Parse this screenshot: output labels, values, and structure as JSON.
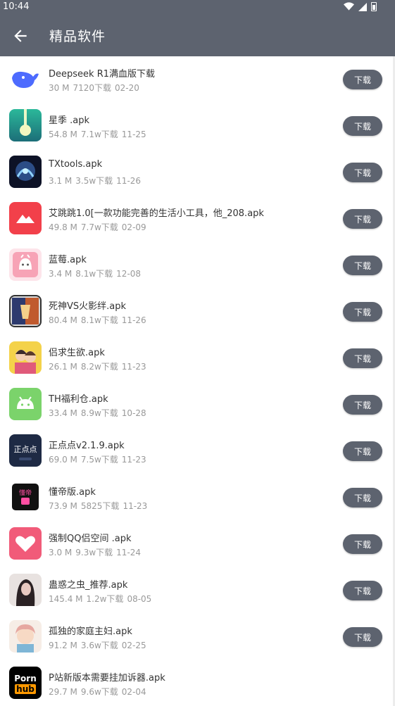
{
  "status_bar": {
    "time": "10:44"
  },
  "header": {
    "title": "精品软件"
  },
  "items": [
    {
      "name": "Deepseek R1满血版下载",
      "size": "30 M",
      "downloads": "7120下载",
      "date": "02-20",
      "button": "下载",
      "icon": "whale-icon",
      "color": "#4d6bfe"
    },
    {
      "name": "星季 .apk",
      "size": "54.8 M",
      "downloads": "7.1w下载",
      "date": "11-25",
      "button": "下载",
      "icon": "star-season-icon",
      "color": "#2f9e8a"
    },
    {
      "name": "TXtools.apk",
      "size": "3.1 M",
      "downloads": "3.5w下载",
      "date": "11-26",
      "button": "下载",
      "icon": "txtools-icon",
      "color": "#1a2440"
    },
    {
      "name": "艾跳跳1.0[一款功能完善的生活小工具，他_208.apk",
      "size": "49.8 M",
      "downloads": "7.7w下载",
      "date": "02-09",
      "button": "下载",
      "icon": "mountain-icon",
      "color": "#f2404a"
    },
    {
      "name": "蓝莓.apk",
      "size": "3.4 M",
      "downloads": "8.1w下载",
      "date": "12-08",
      "button": "下载",
      "icon": "blueberry-icon",
      "color": "#f7a3b6"
    },
    {
      "name": "死神VS火影绊.apk",
      "size": "80.4 M",
      "downloads": "8.1w下载",
      "date": "11-26",
      "button": "下载",
      "icon": "anime-fight-icon",
      "color": "#c05a2e"
    },
    {
      "name": "侣求生欲.apk",
      "size": "26.1 M",
      "downloads": "8.2w下载",
      "date": "11-23",
      "button": "下载",
      "icon": "couple-icon",
      "color": "#f4d24a"
    },
    {
      "name": "TH福利仓.apk",
      "size": "33.4 M",
      "downloads": "8.9w下载",
      "date": "10-28",
      "button": "下载",
      "icon": "android-icon",
      "color": "#7bd36b"
    },
    {
      "name": "正点点v2.1.9.apk",
      "size": "69.0 M",
      "downloads": "7.5w下载",
      "date": "11-23",
      "button": "下载",
      "icon": "zhengdiandian-icon",
      "color": "#1e2a44",
      "icon_text": "正点点"
    },
    {
      "name": "懂帝版.apk",
      "size": "73.9 M",
      "downloads": "5825下载",
      "date": "11-23",
      "button": "下载",
      "icon": "dongdi-icon",
      "color": "#111111"
    },
    {
      "name": "强制QQ侣空间 .apk",
      "size": "3.0 M",
      "downloads": "9.3w下载",
      "date": "11-24",
      "button": "下载",
      "icon": "heart-icon",
      "color": "#f15b79"
    },
    {
      "name": "蛊惑之虫_推荐.apk",
      "size": "145.4 M",
      "downloads": "1.2w下载",
      "date": "08-05",
      "button": "下载",
      "icon": "portrait-icon",
      "color": "#6b4f53"
    },
    {
      "name": "孤独的家庭主妇.apk",
      "size": "91.2 M",
      "downloads": "3.6w下载",
      "date": "02-25",
      "button": "下载",
      "icon": "housewife-icon",
      "color": "#e6a7a0"
    },
    {
      "name": "P站新版本需要挂加诉器.apk",
      "size": "29.7 M",
      "downloads": "9.6w下载",
      "date": "02-04",
      "button": "",
      "icon": "brand-logo-icon",
      "color": "#000000",
      "icon_text_top": "Porn",
      "icon_text_bottom": "hub"
    }
  ]
}
